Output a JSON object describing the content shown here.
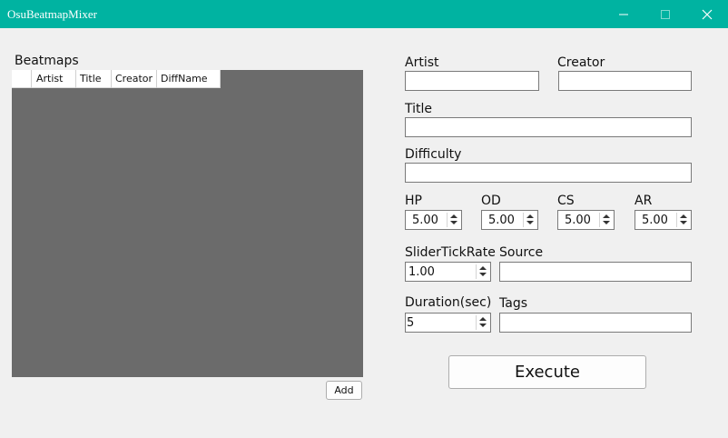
{
  "window": {
    "title": "OsuBeatmapMixer"
  },
  "beatmaps": {
    "label": "Beatmaps",
    "columns": [
      "",
      "Artist",
      "Title",
      "Creator",
      "DiffName"
    ],
    "add_label": "Add"
  },
  "fields": {
    "artist": {
      "label": "Artist",
      "value": ""
    },
    "creator": {
      "label": "Creator",
      "value": ""
    },
    "title": {
      "label": "Title",
      "value": ""
    },
    "difficulty": {
      "label": "Difficulty",
      "value": ""
    },
    "source": {
      "label": "Source",
      "value": ""
    },
    "tags": {
      "label": "Tags",
      "value": ""
    }
  },
  "stats": {
    "hp": {
      "label": "HP",
      "value": "5.00"
    },
    "od": {
      "label": "OD",
      "value": "5.00"
    },
    "cs": {
      "label": "CS",
      "value": "5.00"
    },
    "ar": {
      "label": "AR",
      "value": "5.00"
    }
  },
  "slider_tick_rate": {
    "label": "SliderTickRate",
    "value": "1.00"
  },
  "duration": {
    "label": "Duration(sec)",
    "value": "5"
  },
  "execute_label": "Execute",
  "icons": {
    "minimize": "minimize-icon",
    "maximize": "maximize-icon",
    "close": "close-icon",
    "spin_up": "arrow-up-icon",
    "spin_down": "arrow-down-icon"
  }
}
